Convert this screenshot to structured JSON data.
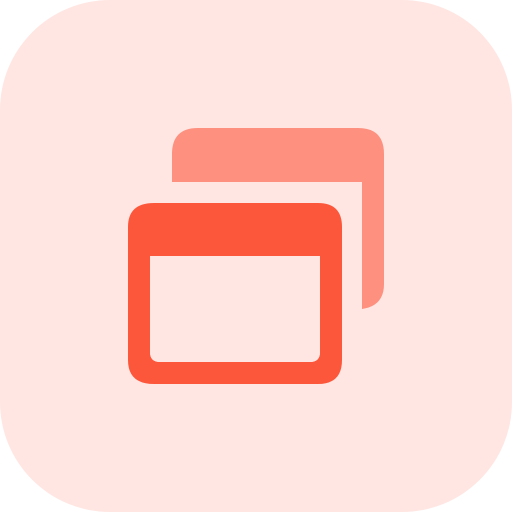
{
  "icon": {
    "name": "multiple-windows-icon",
    "colors": {
      "tile_background": "#FFE6E2",
      "back_window": "#FD907E",
      "front_window": "#FC573B",
      "window_content": "#FFE6E2"
    }
  }
}
